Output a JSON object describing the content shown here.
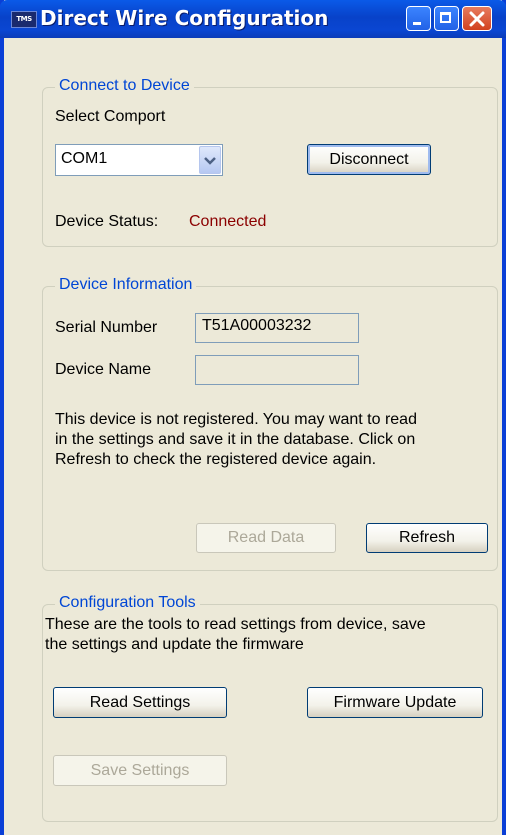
{
  "window": {
    "title": "Direct Wire Configuration",
    "icon_text": "TMS",
    "accent_color": "#0a46d2"
  },
  "connect": {
    "legend": "Connect to Device",
    "comport_label": "Select Comport",
    "comport_value": "COM1",
    "disconnect_label": "Disconnect",
    "status_label": "Device Status:",
    "status_value": "Connected",
    "status_color": "#8b0000"
  },
  "info": {
    "legend": "Device Information",
    "serial_label": "Serial Number",
    "serial_value": "T51A00003232",
    "name_label": "Device Name",
    "name_value": "",
    "message_line1": "This device is not registered. You may want to read",
    "message_line2": "in the settings and save it in the database. Click on",
    "message_line3": "Refresh to check the registered device again.",
    "read_data_label": "Read Data",
    "refresh_label": "Refresh"
  },
  "tools": {
    "legend": "Configuration Tools",
    "desc_line1": "These are the tools to read settings from device, save",
    "desc_line2": "the settings and update the firmware",
    "read_settings_label": "Read Settings",
    "firmware_update_label": "Firmware Update",
    "save_settings_label": "Save Settings"
  }
}
